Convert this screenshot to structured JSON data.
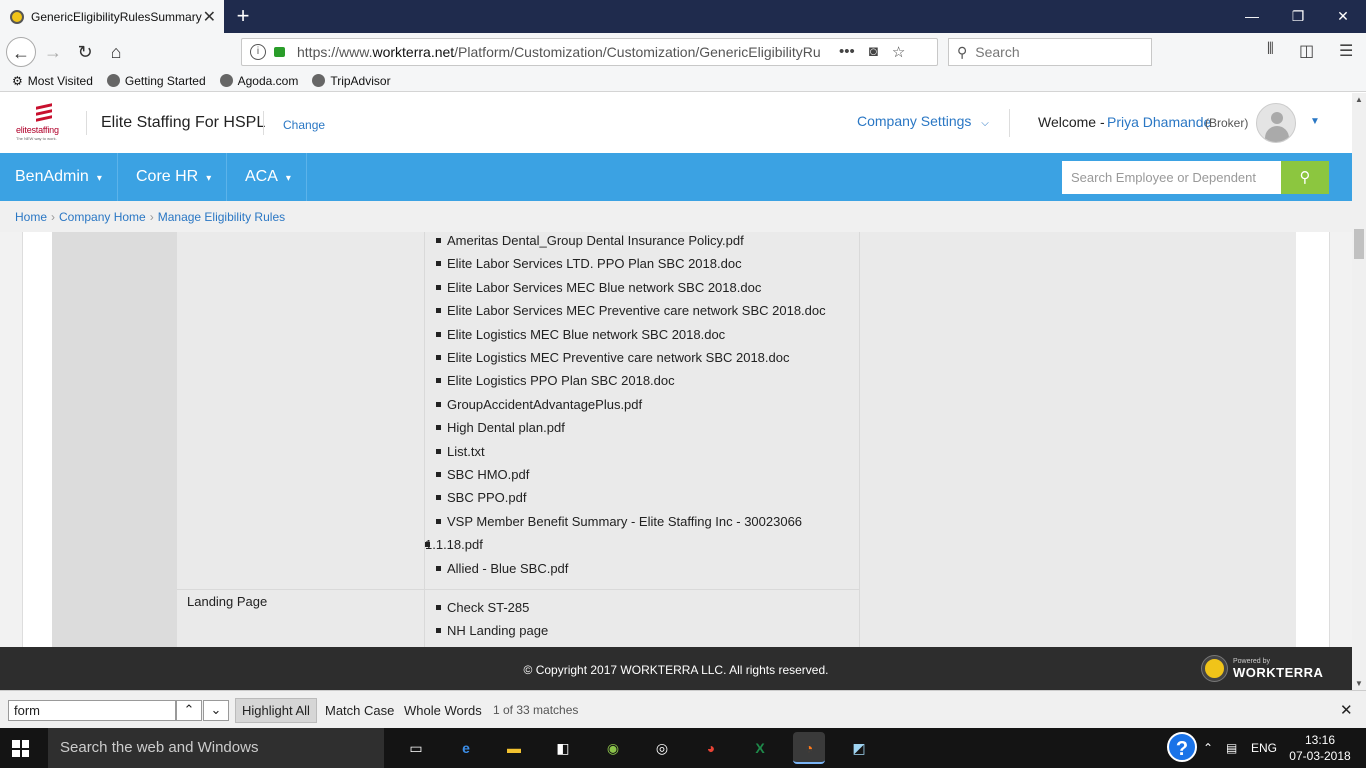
{
  "browser": {
    "tab_title": "GenericEligibilityRulesSummary",
    "tab_close": "✕",
    "new_tab": "+",
    "url_prefix": "https://www.",
    "url_domain": "workterra.net",
    "url_path": "/Platform/Customization/Customization/GenericEligibilityRu",
    "search_placeholder": "Search",
    "bookmarks": [
      "Most Visited",
      "Getting Started",
      "Agoda.com",
      "TripAdvisor"
    ]
  },
  "app": {
    "company_name": "Elite Staffing For HSPL",
    "change_link": "Change",
    "company_settings": "Company Settings",
    "welcome": "Welcome -",
    "user_name": "Priya Dhamande",
    "user_role": "(Broker)",
    "logo_text": "elitestaffing",
    "logo_tagline": "The NEW way to work.",
    "menu": [
      "BenAdmin",
      "Core HR",
      "ACA"
    ],
    "employee_search_placeholder": "Search Employee or Dependent",
    "breadcrumbs": [
      "Home",
      "Company Home",
      "Manage Eligibility Rules"
    ]
  },
  "content": {
    "documents": [
      "Ameritas Dental_Group Dental Insurance Policy.pdf",
      "Elite Labor Services LTD. PPO Plan SBC 2018.doc",
      "Elite Labor Services MEC Blue network SBC 2018.doc",
      "Elite Labor Services MEC Preventive care network SBC 2018.doc",
      "Elite Logistics MEC Blue network SBC 2018.doc",
      "Elite Logistics MEC Preventive care network SBC 2018.doc",
      "Elite Logistics PPO Plan SBC 2018.doc",
      "GroupAccidentAdvantagePlus.pdf",
      "High Dental plan.pdf",
      "List.txt",
      "SBC HMO.pdf",
      "SBC PPO.pdf",
      "VSP Member Benefit Summary - Elite Staffing Inc - 30023066",
      "Allied - Blue SBC.pdf"
    ],
    "vsp_continuation": "1.1.18.pdf",
    "landing_label": "Landing Page",
    "landing_pages": [
      "Check ST-285",
      "NH Landing page"
    ]
  },
  "footer": {
    "copyright": "© Copyright 2017 WORKTERRA LLC. All rights reserved.",
    "powered_by": "Powered by",
    "brand": "WORKTERRA"
  },
  "findbar": {
    "query": "form",
    "highlight_all": "Highlight All",
    "match_case": "Match Case",
    "whole_words": "Whole Words",
    "count": "1 of 33 matches"
  },
  "taskbar": {
    "search_placeholder": "Search the web and Windows",
    "language": "ENG",
    "time": "13:16",
    "date": "07-03-2018"
  }
}
